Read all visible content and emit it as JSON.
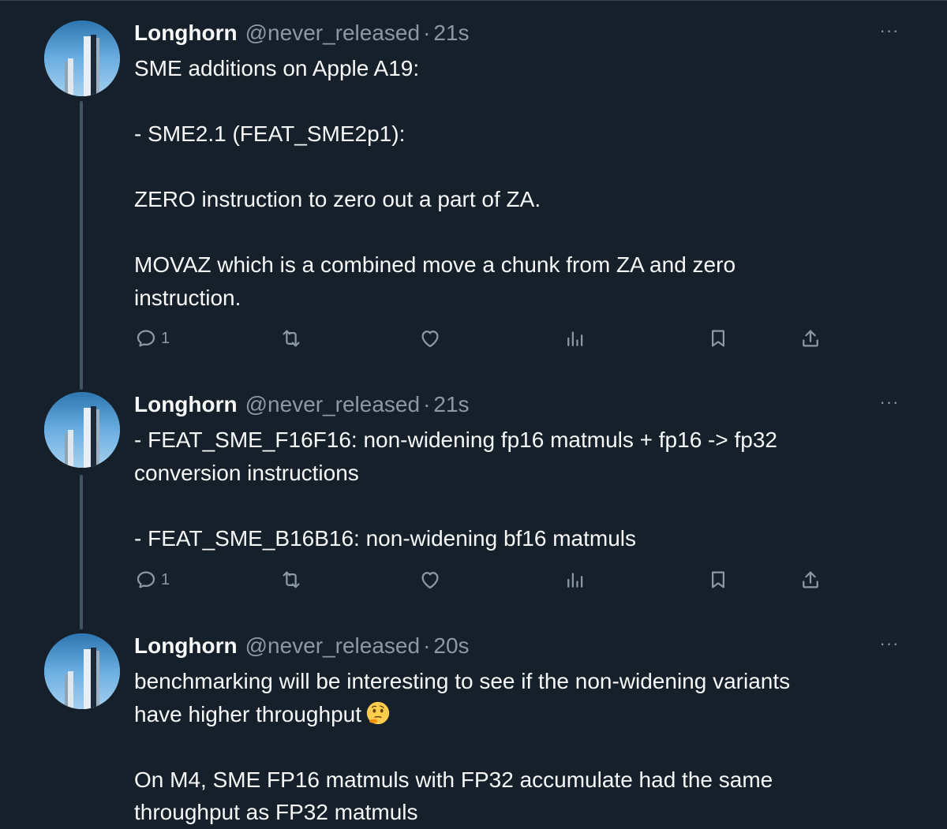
{
  "tweets": [
    {
      "name": "Longhorn",
      "handle": "@never_released",
      "separator": "·",
      "time": "21s",
      "more": "···",
      "lines": [
        "SME additions on Apple A19:",
        "",
        "- SME2.1 (FEAT_SME2p1):",
        "",
        "ZERO instruction to zero out a part of ZA.",
        "",
        "MOVAZ which is a combined move a chunk from ZA and zero",
        "instruction."
      ],
      "reply_count": "1"
    },
    {
      "name": "Longhorn",
      "handle": "@never_released",
      "separator": "·",
      "time": "21s",
      "more": "···",
      "lines": [
        "- FEAT_SME_F16F16: non-widening fp16 matmuls + fp16 -> fp32",
        "conversion instructions",
        "",
        "- FEAT_SME_B16B16: non-widening bf16 matmuls"
      ],
      "reply_count": "1"
    },
    {
      "name": "Longhorn",
      "handle": "@never_released",
      "separator": "·",
      "time": "20s",
      "more": "···",
      "lines": [
        "benchmarking will be interesting to see if the non-widening variants",
        "have higher throughput",
        "",
        "On M4, SME FP16 matmuls with FP32 accumulate had the same",
        "throughput as FP32 matmuls"
      ],
      "emoji": "thinking-face-emoji"
    }
  ],
  "icons": {
    "reply": "reply-icon",
    "retweet": "retweet-icon",
    "like": "like-icon",
    "views": "views-icon",
    "bookmark": "bookmark-icon",
    "share": "share-icon"
  },
  "colors": {
    "background": "#15202b",
    "text": "#f7f9f9",
    "secondary": "#8b98a5",
    "thread_line": "#425364"
  }
}
